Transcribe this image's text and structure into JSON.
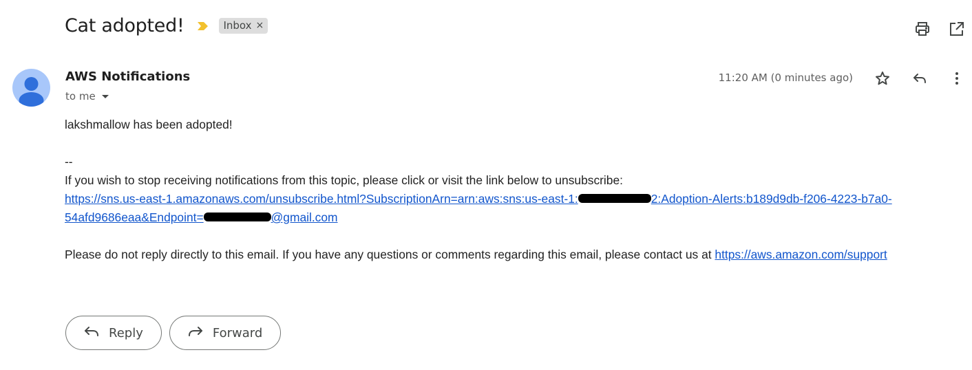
{
  "subject": "Cat adopted!",
  "label": {
    "name": "Inbox",
    "remove": "×"
  },
  "sender": {
    "name": "AWS Notifications",
    "recipient": "to me",
    "time": "11:20 AM (0 minutes ago)"
  },
  "body": {
    "line1": "lakshmallow has been adopted!",
    "separator": "--",
    "unsub_text": "If you wish to stop receiving notifications from this topic, please click or visit the link below to unsubscribe:",
    "link_part1": "https://sns.us-east-1.amazonaws.com/unsubscribe.html?SubscriptionArn=arn:aws:sns:us-east-1:",
    "link_part2": "2:Adoption-Alerts:b189d9db-f206-4223-b7a0-",
    "link_part3": "54afd9686eaa&Endpoint=",
    "link_part4": "@gmail.com",
    "footer_text": "Please do not reply directly to this email. If you have any questions or comments regarding this email, please contact us at ",
    "support_link": "https://aws.amazon.com/support"
  },
  "actions": {
    "reply": "Reply",
    "forward": "Forward"
  },
  "colors": {
    "accent_link": "#1155cc",
    "importance_marker": "#f2c12e",
    "avatar_bg": "#a8c7fa",
    "avatar_fg": "#2f6fdb"
  },
  "icons": [
    "print-icon",
    "open-in-new-window-icon",
    "star-icon",
    "reply-icon",
    "more-vert-icon",
    "dropdown-icon"
  ]
}
